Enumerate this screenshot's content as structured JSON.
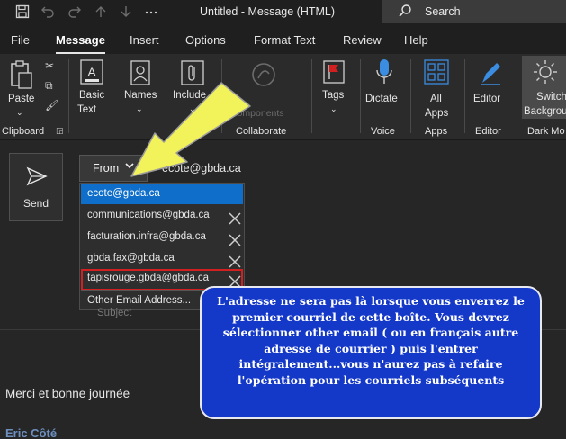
{
  "titlebar": {
    "title": "Untitled  -  Message (HTML)",
    "search_label": "Search",
    "icons": [
      "save-icon",
      "undo-icon",
      "redo-icon",
      "up-icon",
      "down-icon",
      "more-icon",
      "search-icon"
    ]
  },
  "tabs": [
    {
      "label": "File"
    },
    {
      "label": "Message",
      "active": true
    },
    {
      "label": "Insert"
    },
    {
      "label": "Options"
    },
    {
      "label": "Format Text"
    },
    {
      "label": "Review"
    },
    {
      "label": "Help"
    }
  ],
  "ribbon": {
    "paste": "Paste",
    "basic_text_1": "Basic",
    "basic_text_2": "Text",
    "names": "Names",
    "include": "Include",
    "components": "Components",
    "tags": "Tags",
    "dictate": "Dictate",
    "all_apps_1": "All",
    "all_apps_2": "Apps",
    "editor": "Editor",
    "switch_1": "Switch",
    "switch_2": "Backgrou",
    "groups": {
      "clipboard": "Clipboard",
      "collaborate": "Collaborate",
      "voice": "Voice",
      "apps": "Apps",
      "editor": "Editor",
      "dark_mode": "Dark Mo"
    },
    "accent_color": "#3a8de0"
  },
  "compose": {
    "send": "Send",
    "from": "From",
    "from_address": "ecote@gbda.ca",
    "subject_ghost": "Subject",
    "body_line": "Merci et bonne journée",
    "signature": "Eric Côté"
  },
  "dropdown": {
    "items": [
      {
        "label": "ecote@gbda.ca",
        "selected": true
      },
      {
        "label": "communications@gbda.ca"
      },
      {
        "label": "facturation.infra@gbda.ca"
      },
      {
        "label": "gbda.fax@gbda.ca"
      },
      {
        "label": "tapisrouge.gbda@gbda.ca",
        "highlighted": true
      }
    ],
    "other": "Other Email Address...",
    "selected_color": "#0f6ec9",
    "highlight_color": "#d21f1f"
  },
  "callout": {
    "text": "L'adresse ne sera pas là lorsque vous enverrez le premier courriel de cette boîte. Vous devrez sélectionner other email ( ou en français autre adresse de courrier ) puis l'entrer intégralement...vous n'aurez pas à refaire l'opération pour les courriels subséquents",
    "bg_color": "#1438c8",
    "arrow_color": "#f2f25a"
  }
}
